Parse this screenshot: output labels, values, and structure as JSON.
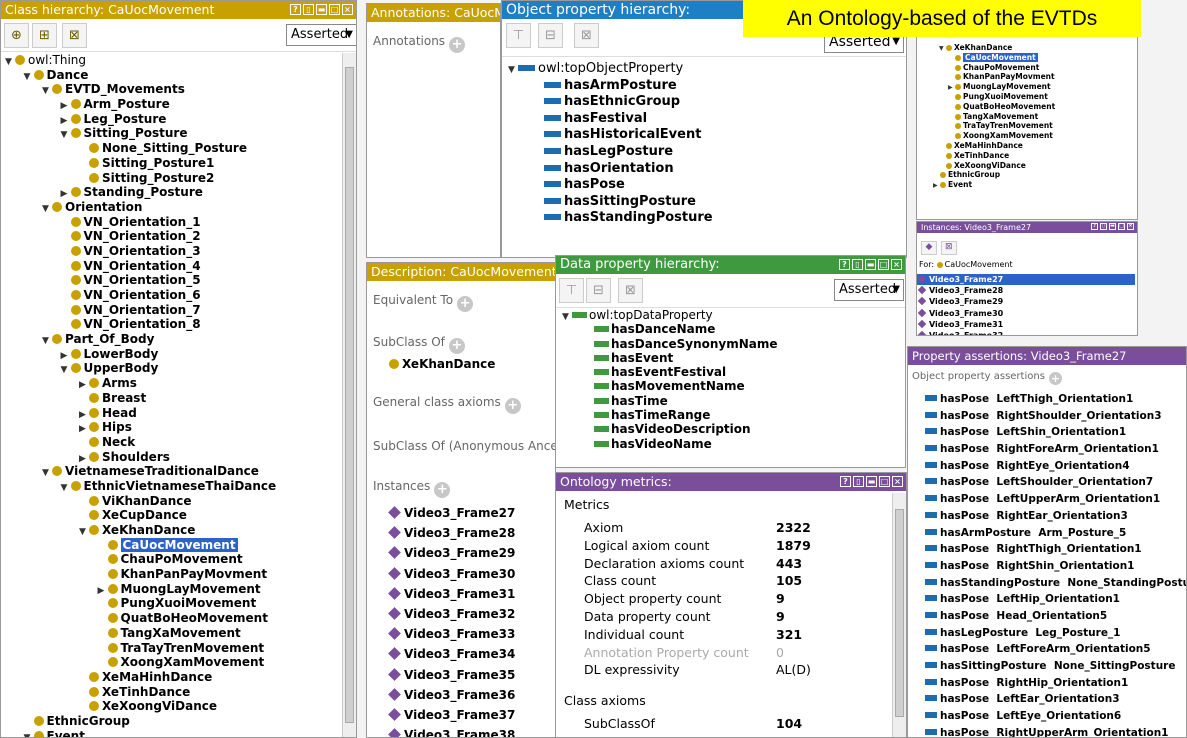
{
  "banner": {
    "title": "An Ontology-based of the EVTDs"
  },
  "class_panel": {
    "title": "Class hierarchy: CaUocMovement",
    "mode": "Asserted",
    "tree": [
      {
        "label": "owl:Thing",
        "level": 0,
        "toggle": "open",
        "icon": "dot"
      },
      {
        "label": "Dance",
        "level": 1,
        "toggle": "open",
        "icon": "dot"
      },
      {
        "label": "EVTD_Movements",
        "level": 2,
        "toggle": "open",
        "icon": "dot"
      },
      {
        "label": "Arm_Posture",
        "level": 3,
        "toggle": "closed",
        "icon": "dot"
      },
      {
        "label": "Leg_Posture",
        "level": 3,
        "toggle": "closed",
        "icon": "dot"
      },
      {
        "label": "Sitting_Posture",
        "level": 3,
        "toggle": "open",
        "icon": "dot"
      },
      {
        "label": "None_Sitting_Posture",
        "level": 4,
        "toggle": "",
        "icon": "dot"
      },
      {
        "label": "Sitting_Posture1",
        "level": 4,
        "toggle": "",
        "icon": "dot"
      },
      {
        "label": "Sitting_Posture2",
        "level": 4,
        "toggle": "",
        "icon": "dot"
      },
      {
        "label": "Standing_Posture",
        "level": 3,
        "toggle": "closed",
        "icon": "dot"
      },
      {
        "label": "Orientation",
        "level": 2,
        "toggle": "open",
        "icon": "dot"
      },
      {
        "label": "VN_Orientation_1",
        "level": 3,
        "toggle": "",
        "icon": "dot"
      },
      {
        "label": "VN_Orientation_2",
        "level": 3,
        "toggle": "",
        "icon": "dot"
      },
      {
        "label": "VN_Orientation_3",
        "level": 3,
        "toggle": "",
        "icon": "dot"
      },
      {
        "label": "VN_Orientation_4",
        "level": 3,
        "toggle": "",
        "icon": "dot"
      },
      {
        "label": "VN_Orientation_5",
        "level": 3,
        "toggle": "",
        "icon": "dot"
      },
      {
        "label": "VN_Orientation_6",
        "level": 3,
        "toggle": "",
        "icon": "dot"
      },
      {
        "label": "VN_Orientation_7",
        "level": 3,
        "toggle": "",
        "icon": "dot"
      },
      {
        "label": "VN_Orientation_8",
        "level": 3,
        "toggle": "",
        "icon": "dot"
      },
      {
        "label": "Part_Of_Body",
        "level": 2,
        "toggle": "open",
        "icon": "dot"
      },
      {
        "label": "LowerBody",
        "level": 3,
        "toggle": "closed",
        "icon": "dot"
      },
      {
        "label": "UpperBody",
        "level": 3,
        "toggle": "open",
        "icon": "dot"
      },
      {
        "label": "Arms",
        "level": 4,
        "toggle": "closed",
        "icon": "dot"
      },
      {
        "label": "Breast",
        "level": 4,
        "toggle": "",
        "icon": "dot"
      },
      {
        "label": "Head",
        "level": 4,
        "toggle": "closed",
        "icon": "dot"
      },
      {
        "label": "Hips",
        "level": 4,
        "toggle": "closed",
        "icon": "dot"
      },
      {
        "label": "Neck",
        "level": 4,
        "toggle": "",
        "icon": "dot"
      },
      {
        "label": "Shoulders",
        "level": 4,
        "toggle": "closed",
        "icon": "dot"
      },
      {
        "label": "VietnameseTraditionalDance",
        "level": 2,
        "toggle": "open",
        "icon": "dot"
      },
      {
        "label": "EthnicVietnameseThaiDance",
        "level": 3,
        "toggle": "open",
        "icon": "dot"
      },
      {
        "label": "ViKhanDance",
        "level": 4,
        "toggle": "",
        "icon": "dot"
      },
      {
        "label": "XeCupDance",
        "level": 4,
        "toggle": "",
        "icon": "dot"
      },
      {
        "label": "XeKhanDance",
        "level": 4,
        "toggle": "open",
        "icon": "dot"
      },
      {
        "label": "CaUocMovement",
        "level": 5,
        "toggle": "",
        "icon": "dot",
        "selected": true
      },
      {
        "label": "ChauPoMovement",
        "level": 5,
        "toggle": "",
        "icon": "dot"
      },
      {
        "label": "KhanPanPayMovment",
        "level": 5,
        "toggle": "",
        "icon": "dot"
      },
      {
        "label": "MuongLayMovement",
        "level": 5,
        "toggle": "closed",
        "icon": "dot"
      },
      {
        "label": "PungXuoiMovement",
        "level": 5,
        "toggle": "",
        "icon": "dot"
      },
      {
        "label": "QuatBoHeoMovement",
        "level": 5,
        "toggle": "",
        "icon": "dot"
      },
      {
        "label": "TangXaMovement",
        "level": 5,
        "toggle": "",
        "icon": "dot"
      },
      {
        "label": "TraTayTrenMovement",
        "level": 5,
        "toggle": "",
        "icon": "dot"
      },
      {
        "label": "XoongXamMovement",
        "level": 5,
        "toggle": "",
        "icon": "dot"
      },
      {
        "label": "XeMaHinhDance",
        "level": 4,
        "toggle": "",
        "icon": "dot"
      },
      {
        "label": "XeTinhDance",
        "level": 4,
        "toggle": "",
        "icon": "dot"
      },
      {
        "label": "XeXoongViDance",
        "level": 4,
        "toggle": "",
        "icon": "dot"
      },
      {
        "label": "EthnicGroup",
        "level": 1,
        "toggle": "",
        "icon": "dot"
      },
      {
        "label": "Event",
        "level": 1,
        "toggle": "open",
        "icon": "dot"
      }
    ]
  },
  "annotations_panel": {
    "title": "Annotations: CaUocMovement",
    "label": "Annotations"
  },
  "description_panel": {
    "title": "Description: CaUocMovement",
    "equivalent": "Equivalent To",
    "subclass": "SubClass Of",
    "subclass_value": "XeKhanDance",
    "general": "General class axioms",
    "anon": "SubClass Of (Anonymous Ancestor)",
    "instances_label": "Instances",
    "instances": [
      "Video3_Frame27",
      "Video3_Frame28",
      "Video3_Frame29",
      "Video3_Frame30",
      "Video3_Frame31",
      "Video3_Frame32",
      "Video3_Frame33",
      "Video3_Frame34",
      "Video3_Frame35",
      "Video3_Frame36",
      "Video3_Frame37",
      "Video3_Frame38"
    ]
  },
  "object_prop_panel": {
    "title": "Object property hierarchy:",
    "mode": "Asserted",
    "root": "owl:topObjectProperty",
    "items": [
      "hasArmPosture",
      "hasEthnicGroup",
      "hasFestival",
      "hasHistoricalEvent",
      "hasLegPosture",
      "hasOrientation",
      "hasPose",
      "hasSittingPosture",
      "hasStandingPosture"
    ]
  },
  "data_prop_panel": {
    "title": "Data property hierarchy:",
    "mode": "Asserted",
    "root": "owl:topDataProperty",
    "items": [
      "hasDanceName",
      "hasDanceSynonymName",
      "hasEvent",
      "hasEventFestival",
      "hasMovementName",
      "hasTime",
      "hasTimeRange",
      "hasVideoDescription",
      "hasVideoName"
    ]
  },
  "metrics_panel": {
    "title": "Ontology metrics:",
    "section": "Metrics",
    "rows": [
      {
        "k": "Axiom",
        "v": "2322"
      },
      {
        "k": "Logical axiom count",
        "v": "1879"
      },
      {
        "k": "Declaration axioms count",
        "v": "443"
      },
      {
        "k": "Class count",
        "v": "105"
      },
      {
        "k": "Object property count",
        "v": "9"
      },
      {
        "k": "Data property count",
        "v": "9"
      },
      {
        "k": "Individual count",
        "v": "321"
      },
      {
        "k": "Annotation Property count",
        "v": "0",
        "dim": true
      },
      {
        "k": "DL expressivity",
        "v": "AL(D)",
        "plain": true
      }
    ],
    "section2": "Class axioms",
    "rows2": [
      {
        "k": "SubClassOf",
        "v": "104"
      }
    ]
  },
  "mini_tree": {
    "items": [
      {
        "label": "XeKhanDance",
        "level": 0,
        "toggle": "open"
      },
      {
        "label": "CaUocMovement",
        "level": 1,
        "toggle": "",
        "selected": true
      },
      {
        "label": "ChauPoMovement",
        "level": 1,
        "toggle": ""
      },
      {
        "label": "KhanPanPayMovment",
        "level": 1,
        "toggle": ""
      },
      {
        "label": "MuongLayMovement",
        "level": 1,
        "toggle": "closed"
      },
      {
        "label": "PungXuoiMovement",
        "level": 1,
        "toggle": ""
      },
      {
        "label": "QuatBoHeoMovement",
        "level": 1,
        "toggle": ""
      },
      {
        "label": "TangXaMovement",
        "level": 1,
        "toggle": ""
      },
      {
        "label": "TraTayTrenMovement",
        "level": 1,
        "toggle": ""
      },
      {
        "label": "XoongXamMovement",
        "level": 1,
        "toggle": ""
      },
      {
        "label": "XeMaHinhDance",
        "level": 0,
        "toggle": ""
      },
      {
        "label": "XeTinhDance",
        "level": 0,
        "toggle": ""
      },
      {
        "label": "XeXoongViDance",
        "level": 0,
        "toggle": ""
      },
      {
        "label": "EthnicGroup",
        "level": -2,
        "toggle": ""
      },
      {
        "label": "Event",
        "level": -2,
        "toggle": "closed"
      }
    ]
  },
  "instances_panel": {
    "title": "Instances: Video3_Frame27",
    "for_label": "For:",
    "for_value": "CaUocMovement",
    "items": [
      "Video3_Frame27",
      "Video3_Frame28",
      "Video3_Frame29",
      "Video3_Frame30",
      "Video3_Frame31",
      "Video3_Frame32"
    ]
  },
  "assertions_panel": {
    "title": "Property assertions: Video3_Frame27",
    "label": "Object property assertions",
    "items": [
      {
        "p": "hasPose",
        "v": "LeftThigh_Orientation1"
      },
      {
        "p": "hasPose",
        "v": "RightShoulder_Orientation3"
      },
      {
        "p": "hasPose",
        "v": "LeftShin_Orientation1"
      },
      {
        "p": "hasPose",
        "v": "RightForeArm_Orientation1"
      },
      {
        "p": "hasPose",
        "v": "RightEye_Orientation4"
      },
      {
        "p": "hasPose",
        "v": "LeftShoulder_Orientation7"
      },
      {
        "p": "hasPose",
        "v": "LeftUpperArm_Orientation1"
      },
      {
        "p": "hasPose",
        "v": "RightEar_Orientation3"
      },
      {
        "p": "hasArmPosture",
        "v": "Arm_Posture_5"
      },
      {
        "p": "hasPose",
        "v": "RightThigh_Orientation1"
      },
      {
        "p": "hasPose",
        "v": "RightShin_Orientation1"
      },
      {
        "p": "hasStandingPosture",
        "v": "None_StandingPosture"
      },
      {
        "p": "hasPose",
        "v": "LeftHip_Orientation1"
      },
      {
        "p": "hasPose",
        "v": "Head_Orientation5"
      },
      {
        "p": "hasLegPosture",
        "v": "Leg_Posture_1"
      },
      {
        "p": "hasPose",
        "v": "LeftForeArm_Orientation5"
      },
      {
        "p": "hasSittingPosture",
        "v": "None_SittingPosture"
      },
      {
        "p": "hasPose",
        "v": "RightHip_Orientation1"
      },
      {
        "p": "hasPose",
        "v": "LeftEar_Orientation3"
      },
      {
        "p": "hasPose",
        "v": "LeftEye_Orientation6"
      },
      {
        "p": "hasPose",
        "v": "RightUpperArm_Orientation1"
      }
    ]
  },
  "colors": {
    "class": "#c8a000",
    "object": "#1e6cb0",
    "data": "#3f9a3f",
    "individual": "#7a4e9a",
    "banner": "#ffff00"
  }
}
